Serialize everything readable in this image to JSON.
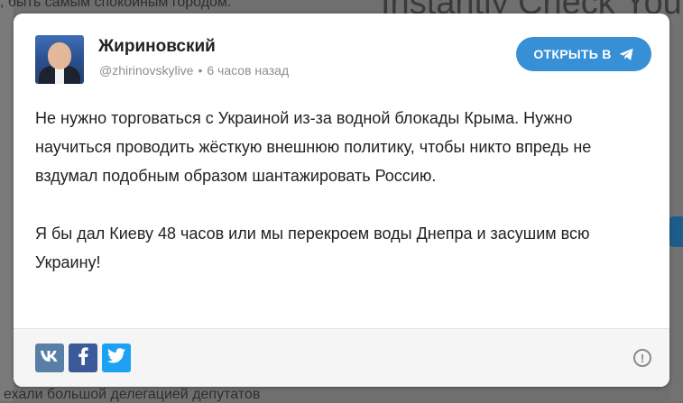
{
  "background": {
    "top_text": ", быть самым спокойным городом.",
    "bottom_text": "ехали большой делегацией депутатов",
    "heading_text": "Instantly Check Your"
  },
  "post": {
    "author": {
      "name": "Жириновский",
      "handle": "@zhirinovskylive",
      "separator": "•",
      "time": "6 часов назад"
    },
    "open_button": {
      "label": "ОТКРЫТЬ В",
      "icon": "telegram-icon",
      "color": "#3790d6"
    },
    "paragraphs": [
      "Не нужно торговаться с Украиной из-за водной блокады Крыма. Нужно научиться проводить жёсткую внешнюю политику, чтобы никто впредь не вздумал подобным образом шантажировать Россию.",
      "Я бы дал Киеву 48 часов или мы перекроем воды Днепра и засушим всю Украину!"
    ]
  },
  "footer": {
    "share_buttons": [
      {
        "name": "vk",
        "icon": "vk-icon",
        "color": "#5a7fa6"
      },
      {
        "name": "facebook",
        "icon": "facebook-icon",
        "color": "#3b5a9a"
      },
      {
        "name": "twitter",
        "icon": "twitter-icon",
        "color": "#1da1f2"
      }
    ],
    "info_icon": "info-icon",
    "info_symbol": "!"
  }
}
